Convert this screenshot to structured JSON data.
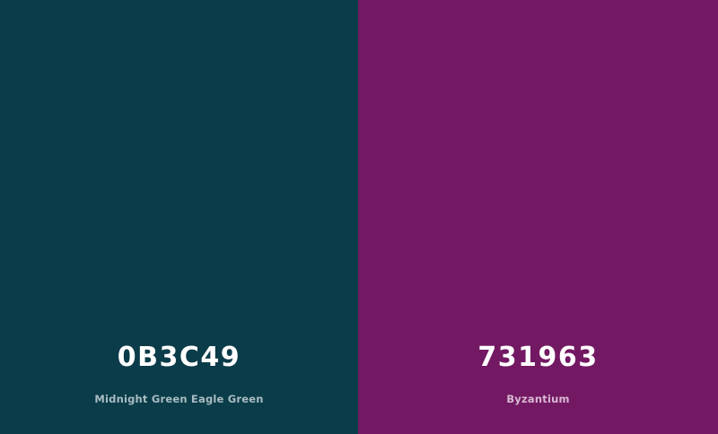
{
  "swatches": [
    {
      "hex": "0B3C49",
      "name": "Midnight Green Eagle Green",
      "color": "#0b3c49",
      "name_color": "#a9bcc2"
    },
    {
      "hex": "731963",
      "name": "Byzantium",
      "color": "#731963",
      "name_color": "#d9b8d3"
    }
  ]
}
